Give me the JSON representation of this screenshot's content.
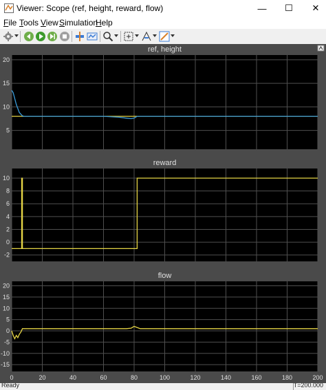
{
  "window": {
    "title": "Viewer: Scope (ref, height, reward, flow)",
    "minimize_glyph": "—",
    "maximize_glyph": "☐",
    "close_glyph": "✕"
  },
  "menu": {
    "items": [
      {
        "label": "File",
        "accel": "F"
      },
      {
        "label": "Tools",
        "accel": "T"
      },
      {
        "label": "View",
        "accel": "V"
      },
      {
        "label": "Simulation",
        "accel": "S"
      },
      {
        "label": "Help",
        "accel": "H"
      }
    ]
  },
  "toolbar": {
    "icons": [
      "gear-icon",
      "configure-icon",
      "step-back-icon",
      "run-icon",
      "step-forward-icon",
      "stop-icon",
      "highlight-icon",
      "signal-select-icon",
      "zoom-icon",
      "autoscale-icon",
      "cursor-measure-icon",
      "triggers-icon",
      "style-icon"
    ]
  },
  "colors": {
    "plot_bg": "#000000",
    "figure_bg": "#4a4a4a",
    "grid": "#4f4f4f",
    "axis_text": "#e0e0e0",
    "signal_yellow": "#e6d545",
    "signal_blue": "#3a9bd9"
  },
  "chart_data": [
    {
      "type": "line",
      "title": "ref, height",
      "xlim": [
        0,
        200
      ],
      "ylim": [
        1,
        21
      ],
      "yticks": [
        5,
        10,
        15,
        20
      ],
      "grid": true,
      "series": [
        {
          "color": "#e6d545",
          "x": [
            0,
            3,
            6,
            8,
            80,
            82,
            200
          ],
          "y": [
            8,
            8,
            8,
            8,
            8,
            8,
            8
          ]
        },
        {
          "color": "#3a9bd9",
          "x": [
            0,
            1,
            3,
            5,
            7,
            8,
            60,
            70,
            75,
            78,
            80,
            82,
            84,
            200
          ],
          "y": [
            13.5,
            13,
            10.5,
            8.8,
            8.1,
            8,
            8,
            7.8,
            7.6,
            7.5,
            7.6,
            8,
            8,
            8
          ]
        }
      ]
    },
    {
      "type": "line",
      "title": "reward",
      "xlim": [
        0,
        200
      ],
      "ylim": [
        -3,
        11.5
      ],
      "yticks": [
        -2,
        0,
        2,
        4,
        6,
        8,
        10
      ],
      "grid": true,
      "series": [
        {
          "color": "#e6d545",
          "x": [
            0,
            6.5,
            6.5,
            7,
            7,
            82,
            82,
            200
          ],
          "y": [
            -1,
            -1,
            10,
            10,
            -1,
            -1,
            10,
            10
          ]
        }
      ]
    },
    {
      "type": "line",
      "title": "flow",
      "xlim": [
        0,
        200
      ],
      "ylim": [
        -18,
        22
      ],
      "xticks": [
        0,
        20,
        40,
        60,
        80,
        100,
        120,
        140,
        160,
        180,
        200
      ],
      "yticks": [
        -15,
        -10,
        -5,
        0,
        5,
        10,
        15,
        20
      ],
      "grid": true,
      "series": [
        {
          "color": "#e6d545",
          "x": [
            0,
            1,
            2,
            3,
            4,
            5,
            6,
            7,
            8,
            70,
            75,
            78,
            80,
            82,
            84,
            88,
            200
          ],
          "y": [
            0,
            -2,
            -3.5,
            -2,
            -3,
            -1.5,
            -0.5,
            1,
            1,
            1,
            1,
            1.2,
            2,
            1.5,
            1,
            1,
            1
          ]
        }
      ]
    }
  ],
  "status": {
    "ready": "Ready",
    "time": "T=200.000"
  }
}
